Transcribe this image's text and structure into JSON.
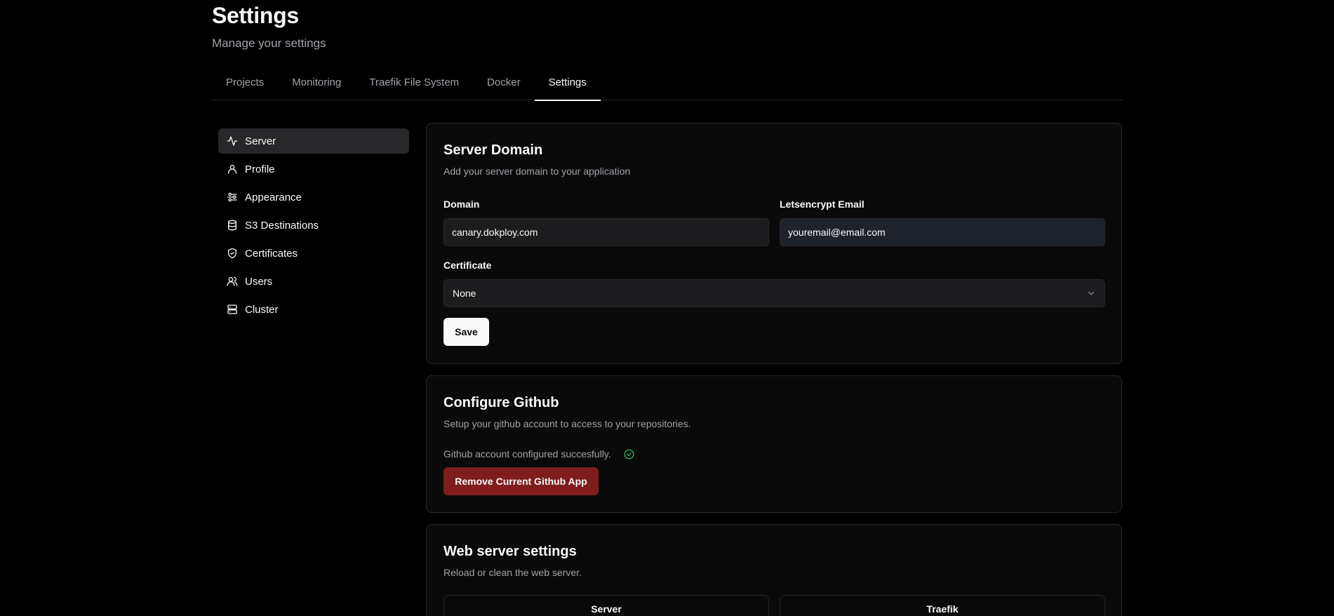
{
  "header": {
    "title": "Settings",
    "subtitle": "Manage your settings"
  },
  "tabs": [
    {
      "label": "Projects",
      "active": false
    },
    {
      "label": "Monitoring",
      "active": false
    },
    {
      "label": "Traefik File System",
      "active": false
    },
    {
      "label": "Docker",
      "active": false
    },
    {
      "label": "Settings",
      "active": true
    }
  ],
  "sidebar": {
    "items": [
      {
        "label": "Server",
        "icon": "activity-icon",
        "active": true
      },
      {
        "label": "Profile",
        "icon": "user-icon",
        "active": false
      },
      {
        "label": "Appearance",
        "icon": "palette-icon",
        "active": false
      },
      {
        "label": "S3 Destinations",
        "icon": "database-icon",
        "active": false
      },
      {
        "label": "Certificates",
        "icon": "shield-check-icon",
        "active": false
      },
      {
        "label": "Users",
        "icon": "users-icon",
        "active": false
      },
      {
        "label": "Cluster",
        "icon": "server-icon",
        "active": false
      }
    ]
  },
  "server_domain": {
    "title": "Server Domain",
    "description": "Add your server domain to your application",
    "domain_label": "Domain",
    "domain_value": "canary.dokploy.com",
    "email_label": "Letsencrypt Email",
    "email_value": "youremail@email.com",
    "certificate_label": "Certificate",
    "certificate_value": "None",
    "save_label": "Save"
  },
  "github": {
    "title": "Configure Github",
    "description": "Setup your github account to access to your repositories.",
    "status_text": "Github account configured succesfully.",
    "remove_label": "Remove Current Github App"
  },
  "web_server": {
    "title": "Web server settings",
    "description": "Reload or clean the web server.",
    "server_label": "Server",
    "traefik_label": "Traefik"
  },
  "colors": {
    "background": "#000000",
    "card": "#0a0a0a",
    "border": "#27272a",
    "danger": "#7f1d1d",
    "success": "#22c55e"
  }
}
